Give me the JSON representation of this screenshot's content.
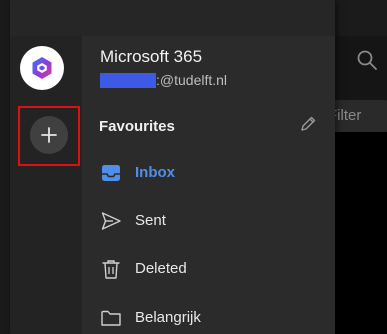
{
  "account": {
    "name": "Microsoft 365",
    "email_domain": ":@tudelft.nl"
  },
  "background": {
    "filter_label": "Filter"
  },
  "favourites": {
    "label": "Favourites"
  },
  "folders": [
    {
      "label": "Inbox",
      "icon": "inbox-icon",
      "selected": true
    },
    {
      "label": "Sent",
      "icon": "send-icon",
      "selected": false
    },
    {
      "label": "Deleted",
      "icon": "trash-icon",
      "selected": false
    },
    {
      "label": "Belangrijk",
      "icon": "folder-icon",
      "selected": false
    }
  ],
  "colors": {
    "accent": "#4f8fe8",
    "highlight_box": "#e01010",
    "redaction": "#3d59e6",
    "drawer_bg": "#2b2b2b"
  }
}
